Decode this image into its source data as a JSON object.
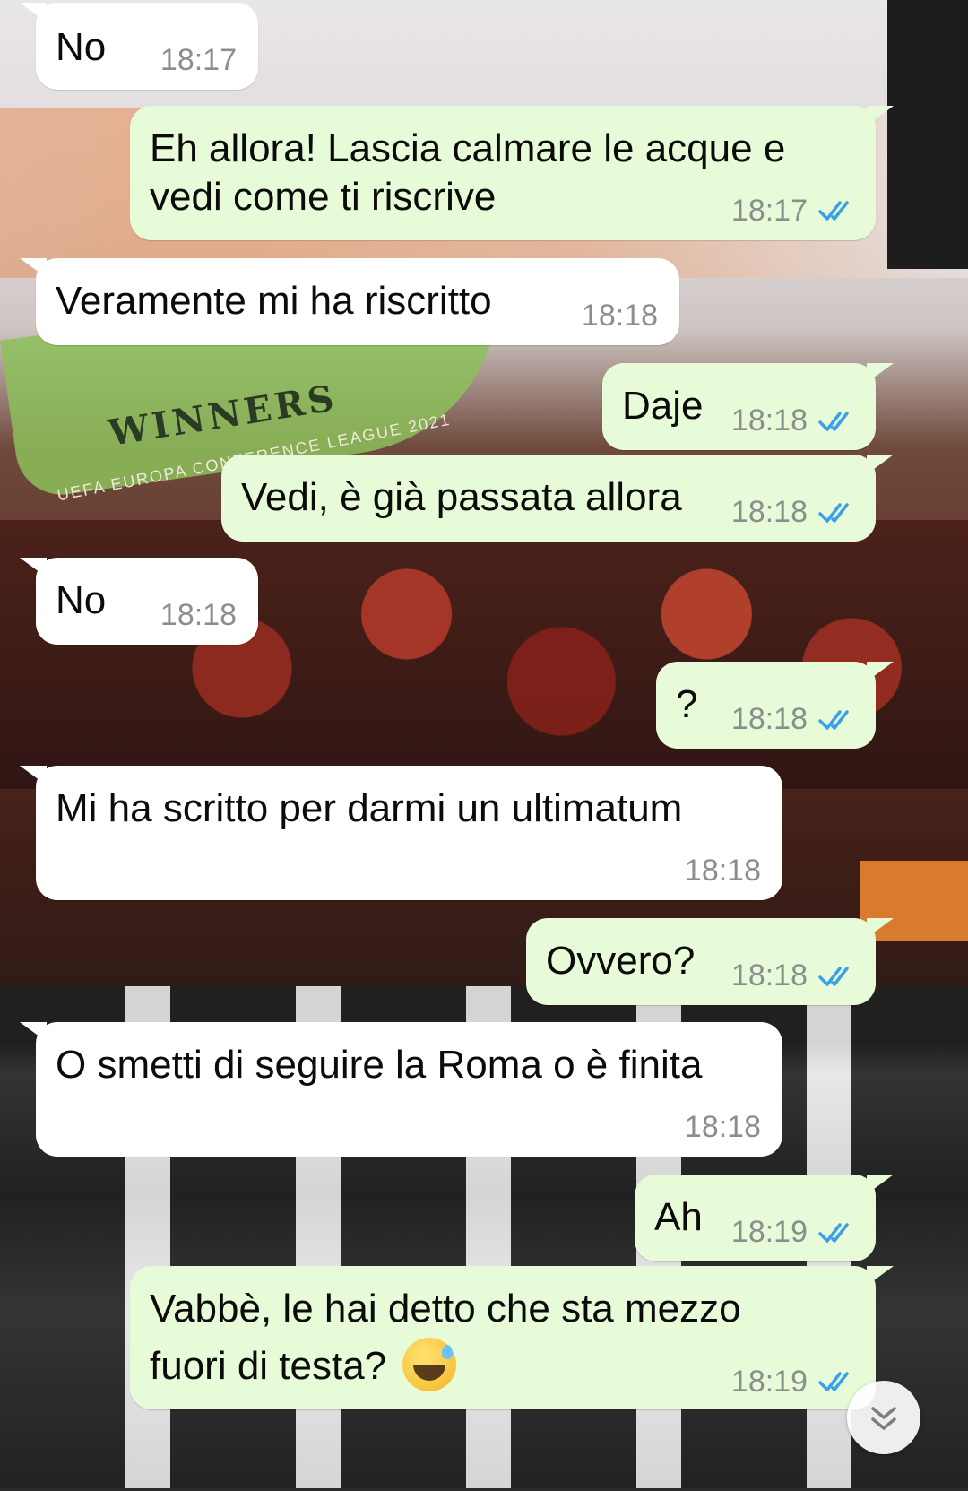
{
  "messages": [
    {
      "dir": "in",
      "text": "No",
      "time": "18:17"
    },
    {
      "dir": "out",
      "text_lines": [
        "Eh allora! Lascia calmare le acque e",
        "vedi come ti riscrive"
      ],
      "time": "18:17",
      "status": "read"
    },
    {
      "dir": "in",
      "text": "Veramente mi ha riscritto",
      "time": "18:18"
    },
    {
      "dir": "out",
      "text": "Daje",
      "time": "18:18",
      "status": "read"
    },
    {
      "dir": "out",
      "text": "Vedi, è già passata allora",
      "time": "18:18",
      "status": "read"
    },
    {
      "dir": "in",
      "text": "No",
      "time": "18:18"
    },
    {
      "dir": "out",
      "text": "?",
      "time": "18:18",
      "status": "read"
    },
    {
      "dir": "in",
      "text": "Mi ha scritto per darmi un ultimatum",
      "time": "18:18"
    },
    {
      "dir": "out",
      "text": "Ovvero?",
      "time": "18:18",
      "status": "read"
    },
    {
      "dir": "in",
      "text": "O smetti di seguire la Roma o è finita",
      "time": "18:18"
    },
    {
      "dir": "out",
      "text": "Ah",
      "time": "18:19",
      "status": "read"
    },
    {
      "dir": "out",
      "text_lines": [
        "Vabbè, le hai detto che sta mezzo",
        "fuori di testa?"
      ],
      "emoji": "grinning-face-with-sweat-icon",
      "time": "18:19",
      "status": "read"
    }
  ],
  "wallpaper": {
    "winners": "WINNERS",
    "subtitle": "UEFA EUROPA CONFERENCE LEAGUE 2021"
  },
  "colors": {
    "incoming_bubble": "#ffffff",
    "outgoing_bubble": "#e8fbd8",
    "read_ticks": "#3aa0e8",
    "timestamp": "#8b8f8c"
  },
  "icons": {
    "read_status": "double-check-icon",
    "scroll_down": "chevron-double-down-icon"
  }
}
